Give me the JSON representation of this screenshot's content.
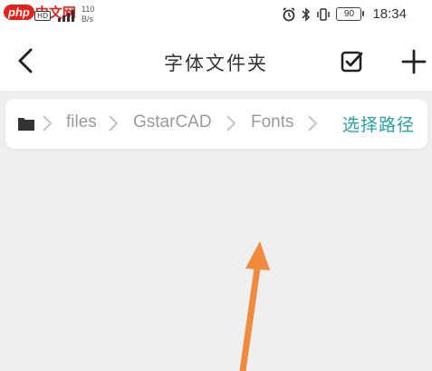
{
  "status_bar": {
    "watermark_php": "php",
    "watermark_cn": "中文网",
    "hd_badge": "HD",
    "net_speed_value": "110",
    "net_speed_unit": "B/s",
    "battery": "90",
    "time": "18:34",
    "icons": [
      "alarm-icon",
      "bluetooth-icon",
      "vibrate-icon",
      "battery-icon"
    ]
  },
  "navbar": {
    "back_icon": "chevron-left-icon",
    "title": "字体文件夹",
    "select_icon": "checkbox-checked-icon",
    "add_icon": "plus-icon"
  },
  "breadcrumb": {
    "root_icon": "folder-icon",
    "items": [
      "files",
      "GstarCAD",
      "Fonts"
    ],
    "action": "选择路径"
  },
  "colors": {
    "accent": "#24a4a4",
    "background": "#efefef",
    "breadcrumb_text": "#9a9a9a",
    "annotation_arrow": "#f08a3c"
  }
}
